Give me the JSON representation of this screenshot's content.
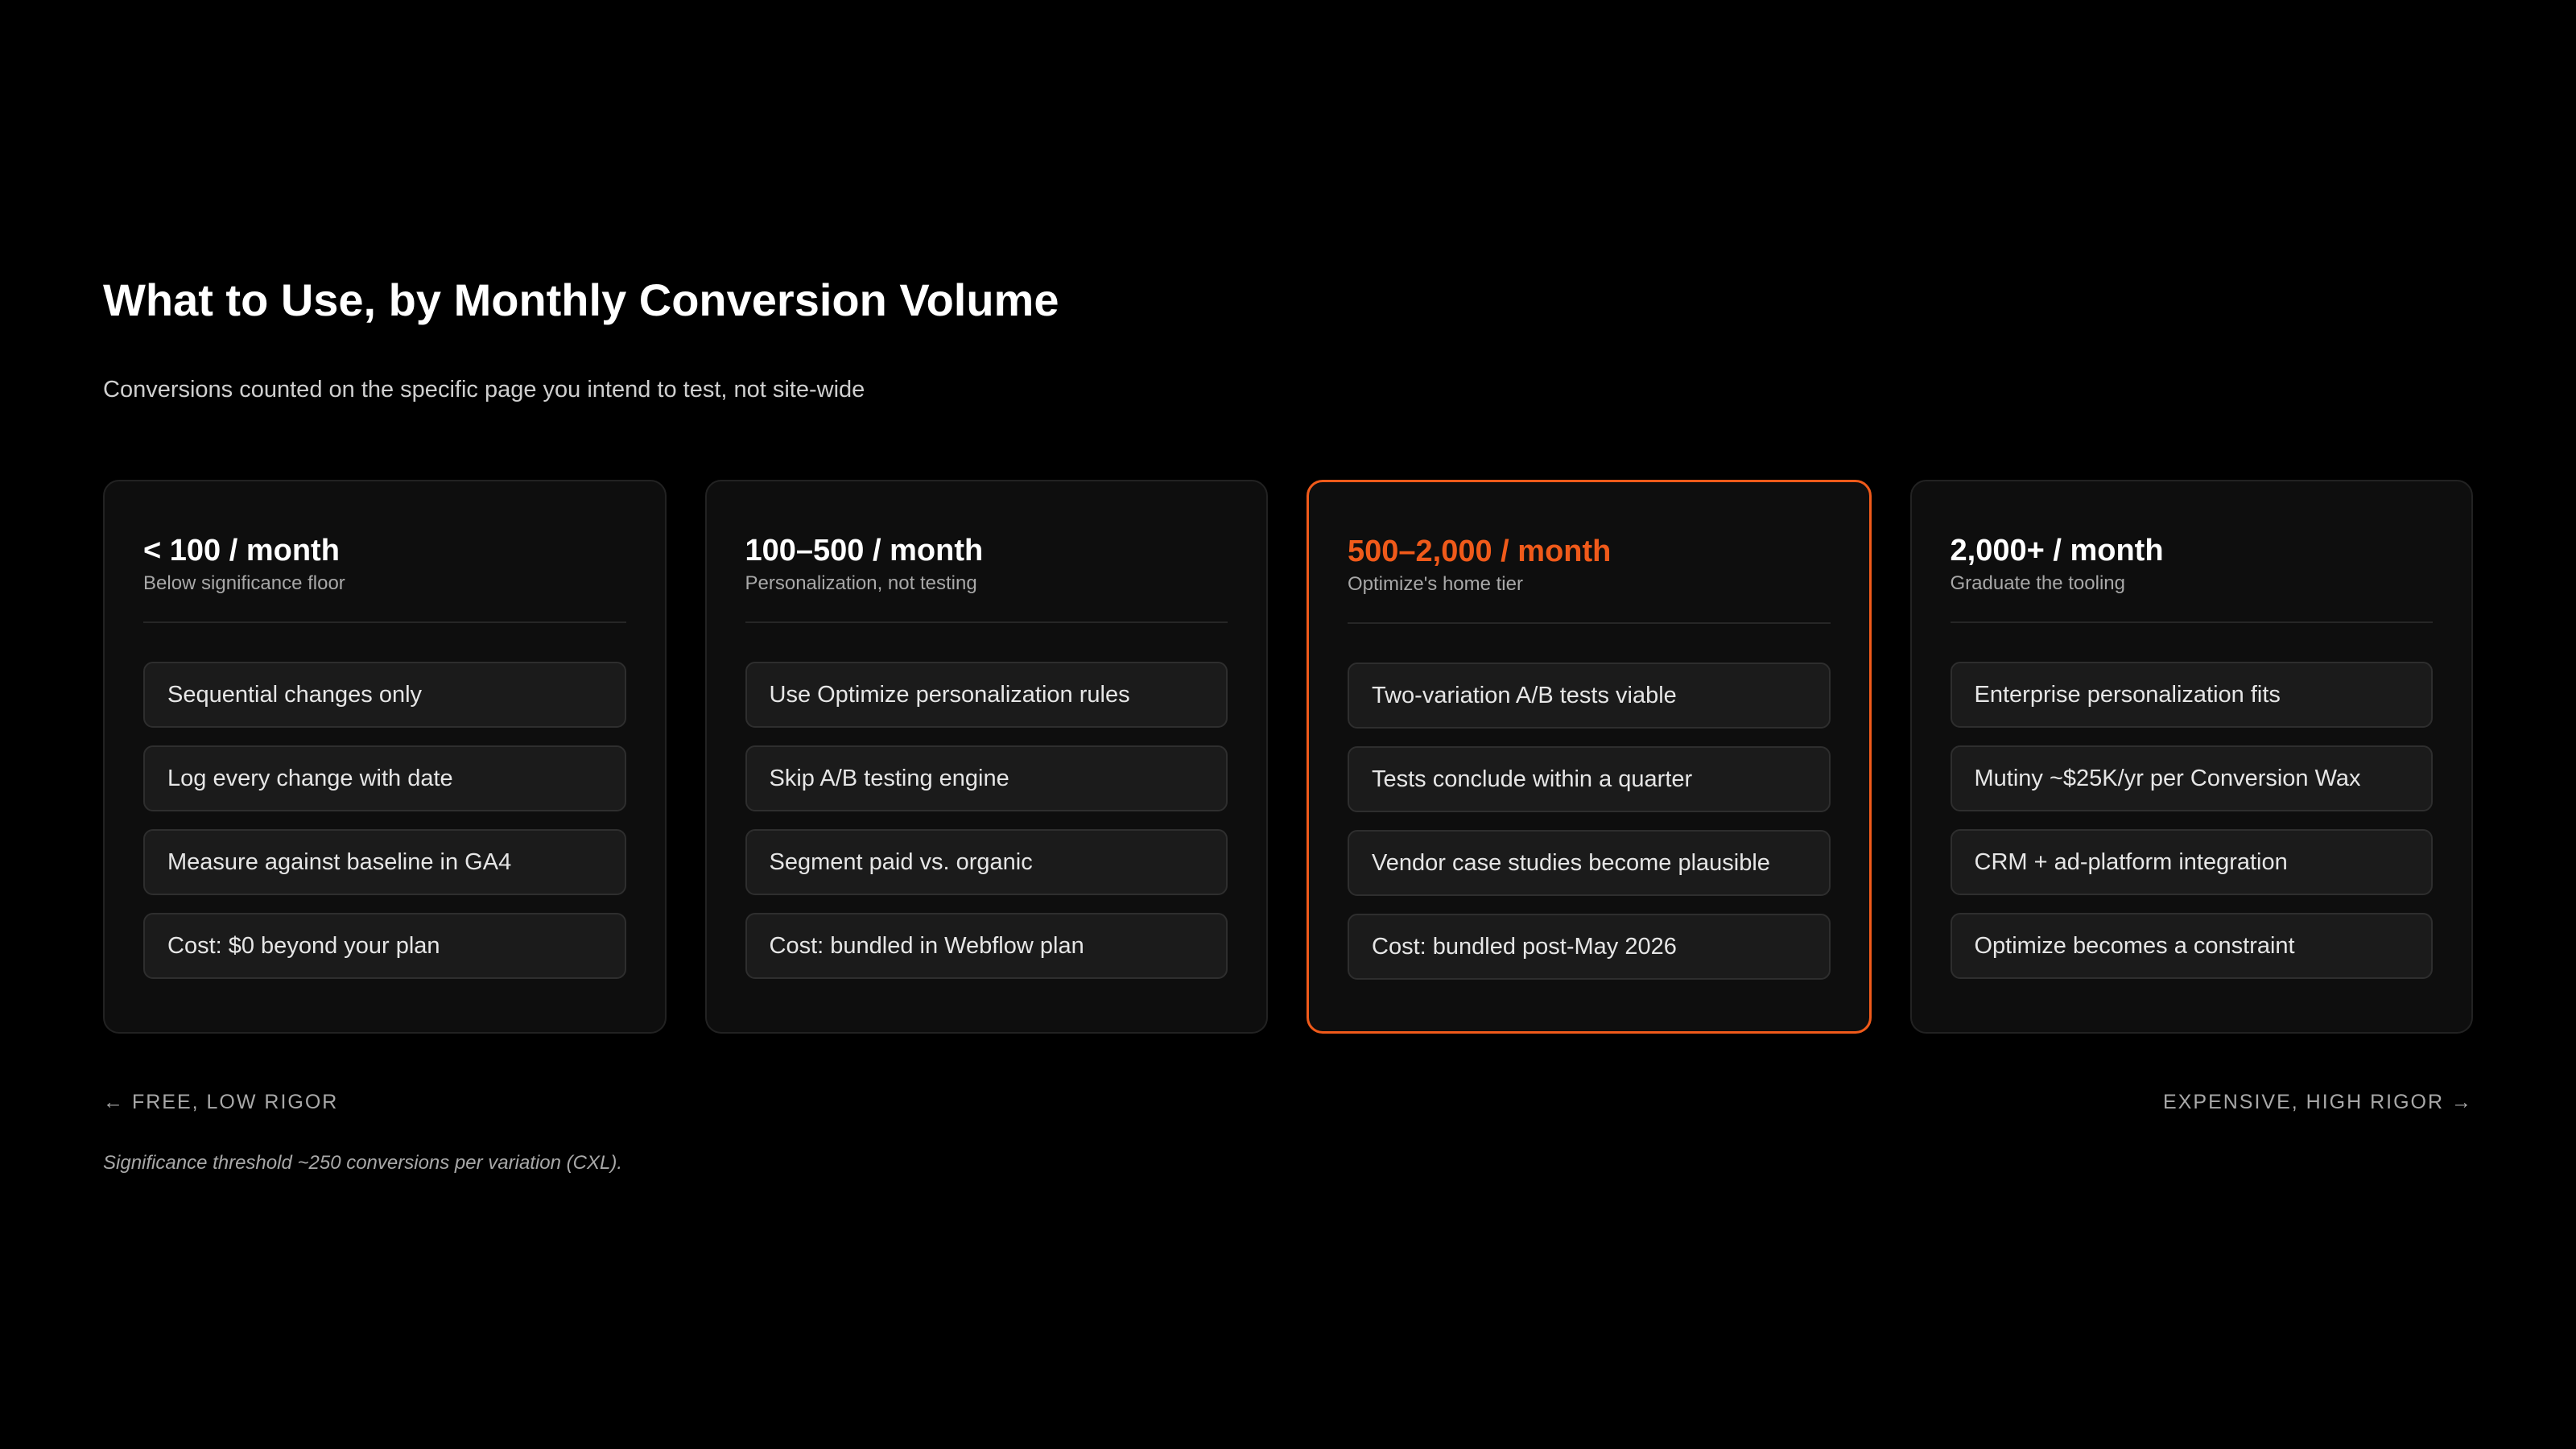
{
  "header": {
    "title": "What to Use, by Monthly Conversion Volume",
    "subtitle": "Conversions counted on the specific page you intend to test, not site-wide"
  },
  "accent_color": "#f05a1a",
  "tiers": [
    {
      "title": "< 100 / month",
      "subtitle": "Below significance floor",
      "highlighted": false,
      "items": [
        "Sequential changes only",
        "Log every change with date",
        "Measure against baseline in GA4",
        "Cost: $0 beyond your plan"
      ]
    },
    {
      "title": "100–500 / month",
      "subtitle": "Personalization, not testing",
      "highlighted": false,
      "items": [
        "Use Optimize personalization rules",
        "Skip A/B testing engine",
        "Segment paid vs. organic",
        "Cost: bundled in Webflow plan"
      ]
    },
    {
      "title": "500–2,000 / month",
      "subtitle": "Optimize's home tier",
      "highlighted": true,
      "items": [
        "Two-variation A/B tests viable",
        "Tests conclude within a quarter",
        "Vendor case studies become plausible",
        "Cost: bundled post-May 2026"
      ]
    },
    {
      "title": "2,000+ / month",
      "subtitle": "Graduate the tooling",
      "highlighted": false,
      "items": [
        "Enterprise personalization fits",
        "Mutiny ~$25K/yr per Conversion Wax",
        "CRM + ad-platform integration",
        "Optimize becomes a constraint"
      ]
    }
  ],
  "axis": {
    "left": "← FREE, LOW RIGOR",
    "right": "EXPENSIVE, HIGH RIGOR →"
  },
  "footnote": "Significance threshold ~250 conversions per variation (CXL)."
}
